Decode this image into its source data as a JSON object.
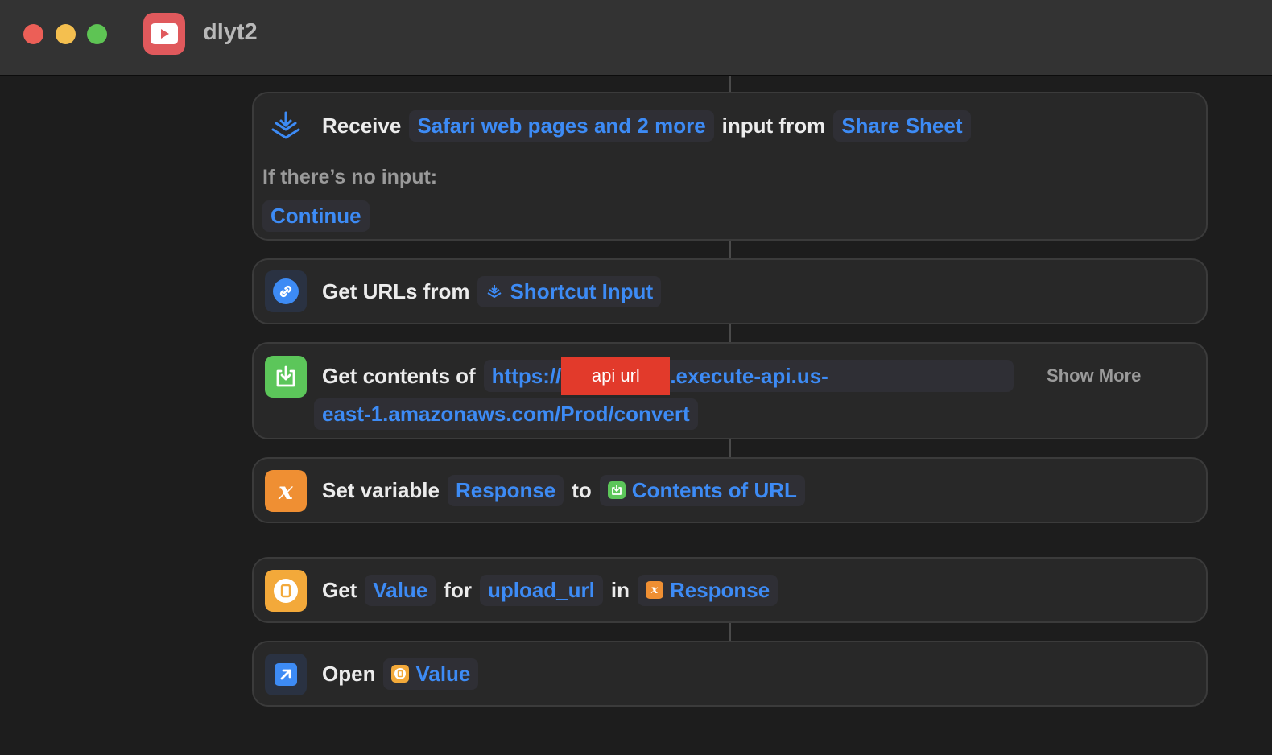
{
  "window": {
    "title": "dlyt2"
  },
  "actions": {
    "receive": {
      "verb": "Receive",
      "input_types": "Safari web pages and 2 more",
      "middle": "input from",
      "source": "Share Sheet",
      "no_input_label": "If there’s no input:",
      "no_input_action": "Continue"
    },
    "get_urls": {
      "verb": "Get URLs from",
      "source": "Shortcut Input"
    },
    "get_contents": {
      "verb": "Get contents of",
      "url_prefix": "https://",
      "redaction": "api url",
      "url_middle": ".execute-api.us-",
      "url_line2": "east-1.amazonaws.com/Prod/convert",
      "show_more": "Show More"
    },
    "set_variable": {
      "verb": "Set variable",
      "name": "Response",
      "to": "to",
      "value": "Contents of URL"
    },
    "get_value": {
      "verb": "Get",
      "type": "Value",
      "for": "for",
      "key": "upload_url",
      "in": "in",
      "dict": "Response"
    },
    "open": {
      "verb": "Open",
      "target": "Value"
    }
  },
  "icons": {
    "app": "play-icon",
    "receive": "stack-arrow-icon",
    "get_urls": "link-icon",
    "get_contents": "download-icon",
    "set_variable": "variable-icon",
    "get_value": "dictionary-icon",
    "open": "open-arrow-icon"
  },
  "colors": {
    "accent": "#3d8bf5",
    "app_icon": "#e0595c",
    "get_contents": "#5cc65a",
    "variable": "#ef8f33",
    "dictionary": "#f3a93a",
    "redaction": "#e23a2b"
  }
}
